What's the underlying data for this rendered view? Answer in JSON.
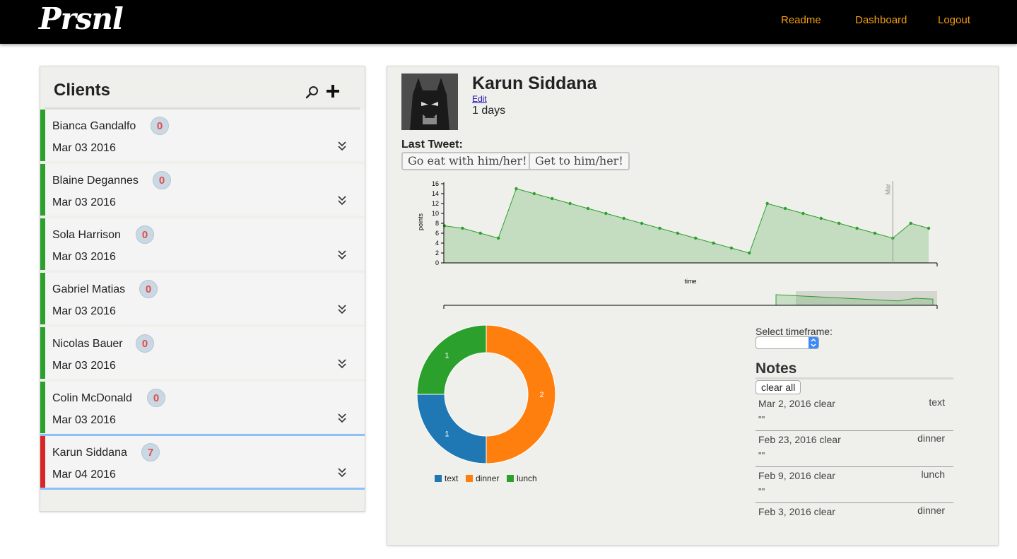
{
  "app": {
    "logo": "Prsnl"
  },
  "nav": {
    "readme": "Readme",
    "dashboard": "Dashboard",
    "logout": "Logout"
  },
  "colors": {
    "accent_orange": "#f39c12",
    "status_green": "#2ca02c",
    "status_red": "#d62728",
    "badge_text": "#e44b4b",
    "selected_border": "#8ec0f5"
  },
  "sidebar": {
    "title": "Clients",
    "search_icon": "search-icon",
    "add_icon": "plus-icon",
    "clients": [
      {
        "name": "Bianca Gandalfo",
        "badge": "0",
        "date": "Mar 03 2016",
        "status": "green"
      },
      {
        "name": "Blaine Degannes",
        "badge": "0",
        "date": "Mar 03 2016",
        "status": "green"
      },
      {
        "name": "Sola Harrison",
        "badge": "0",
        "date": "Mar 03 2016",
        "status": "green"
      },
      {
        "name": "Gabriel Matias",
        "badge": "0",
        "date": "Mar 03 2016",
        "status": "green"
      },
      {
        "name": "Nicolas Bauer",
        "badge": "0",
        "date": "Mar 03 2016",
        "status": "green"
      },
      {
        "name": "Colin McDonald",
        "badge": "0",
        "date": "Mar 03 2016",
        "status": "green"
      },
      {
        "name": "Karun Siddana",
        "badge": "7",
        "date": "Mar 04 2016",
        "status": "red",
        "selected": true
      }
    ]
  },
  "detail": {
    "name": "Karun Siddana",
    "edit": "Edit",
    "days": "1 days",
    "last_tweet_label": "Last Tweet:",
    "tweet_buttons": [
      "Go eat with him/her!",
      "Get to him/her!"
    ],
    "timeframe_label": "Select timeframe:",
    "notes_title": "Notes",
    "clear_all": "clear all",
    "clear_label": "clear",
    "notes": [
      {
        "date": "Mar 2, 2016",
        "type": "text",
        "text": "\"\""
      },
      {
        "date": "Feb 23, 2016",
        "type": "dinner",
        "text": "\"\""
      },
      {
        "date": "Feb 9, 2016",
        "type": "lunch",
        "text": "\"\""
      },
      {
        "date": "Feb 3, 2016",
        "type": "dinner",
        "text": ""
      }
    ]
  },
  "chart_data": [
    {
      "type": "area",
      "xlabel": "time",
      "ylabel": "points",
      "ylim": [
        0,
        16
      ],
      "yticks": [
        0,
        2,
        4,
        6,
        8,
        10,
        12,
        14,
        16
      ],
      "marker_label": "Mar",
      "color": "#2ca02c",
      "series": [
        {
          "values": [
            7.5,
            7,
            6,
            5,
            15,
            14,
            13,
            12,
            11,
            10,
            9,
            8,
            7,
            6,
            5,
            4,
            3,
            2,
            12,
            11,
            10,
            9,
            8,
            7,
            6,
            5,
            8,
            7
          ]
        }
      ]
    },
    {
      "type": "pie",
      "donut": true,
      "categories": [
        "text",
        "dinner",
        "lunch"
      ],
      "values": [
        1,
        2,
        1
      ],
      "colors": [
        "#1f77b4",
        "#ff7f0e",
        "#2ca02c"
      ]
    }
  ]
}
